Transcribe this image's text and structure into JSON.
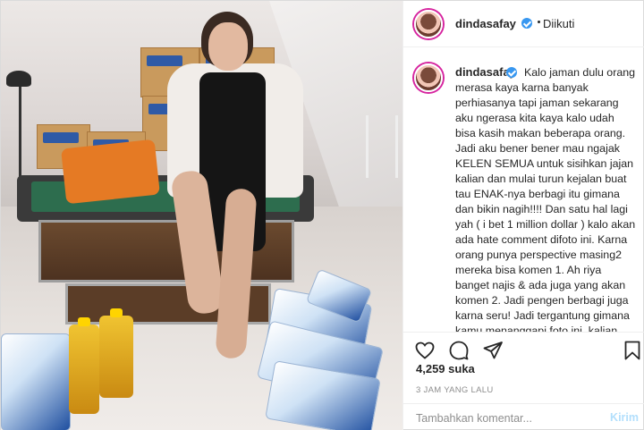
{
  "post": {
    "username": "dindasafay",
    "follow_status": "Diikuti",
    "verified_icon": "verified-badge-icon",
    "caption_username": "dindasafay",
    "caption": "Kalo jaman dulu orang merasa kaya karna banyak perhiasanya tapi jaman sekarang aku ngerasa kita kaya kalo udah bisa kasih makan beberapa orang. Jadi aku bener bener mau ngajak KELEN SEMUA untuk sisihkan jajan kalian dan mulai turun kejalan buat tau ENAK-nya berbagi itu gimana dan bikin nagih!!!! Dan satu hal lagi yah ( i bet 1 million dollar ) kalo akan ada hate comment difoto ini. Karna orang punya perspective masing2 mereka bisa komen 1. Ah riya banget najis & ada juga yang akan komen 2. Jadi pengen berbagi juga karna seru! Jadi tergantung gimana kamu menanggapi foto ini, kalian punya hak untuk mengomentari hidup saya dengan negatif, begitu juga dengan",
    "likes": "4,259 suka",
    "timestamp": "3 JAM YANG LALU"
  },
  "actions": {
    "like_icon": "heart-icon",
    "comment_icon": "comment-icon",
    "share_icon": "share-icon",
    "save_icon": "bookmark-icon"
  },
  "comment_box": {
    "placeholder": "Tambahkan komentar...",
    "send_label": "Kirim"
  },
  "colors": {
    "verified": "#3897f0",
    "send_disabled": "#b2dffc",
    "secondary_text": "#8e8e8e"
  }
}
